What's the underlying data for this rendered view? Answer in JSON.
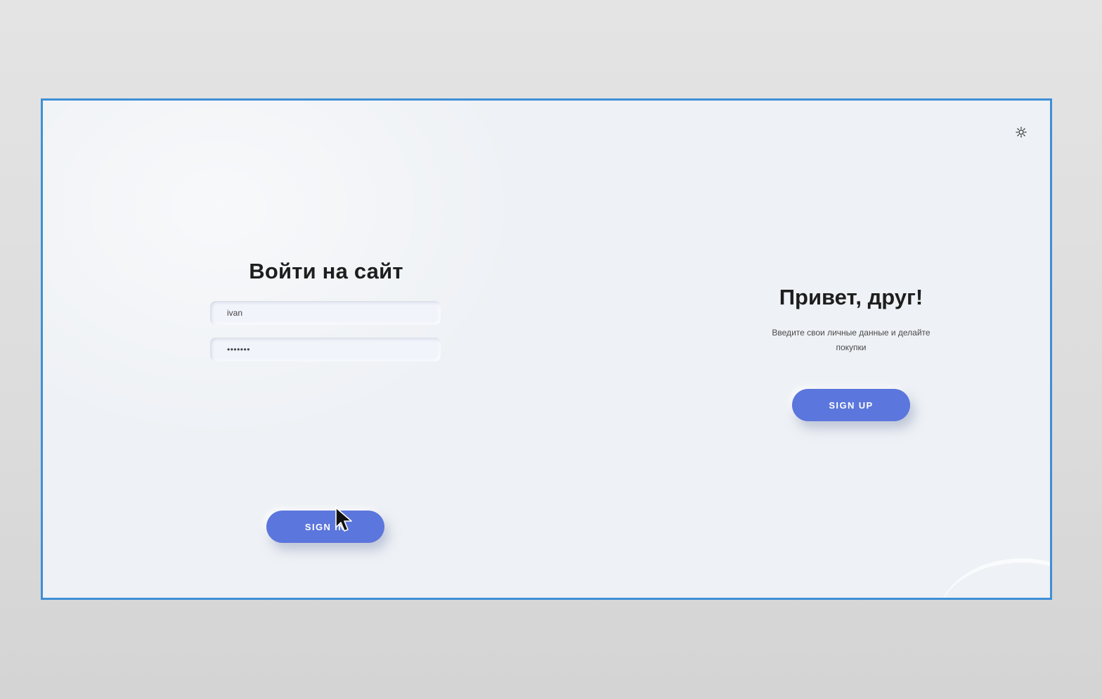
{
  "signin": {
    "title": "Войти на сайт",
    "username_value": "ivan",
    "password_value": "•••••••",
    "button_label": "SIGN IN"
  },
  "signup": {
    "title": "Привет, друг!",
    "description": "Введите свои личные данные и делайте покупки",
    "button_label": "SIGN UP"
  },
  "icons": {
    "theme_toggle": "sun-icon",
    "cursor": "mouse-pointer-icon"
  },
  "colors": {
    "accent": "#5b76dc",
    "frame_border": "#3d8fd6",
    "panel_bg": "#eef1f5"
  }
}
